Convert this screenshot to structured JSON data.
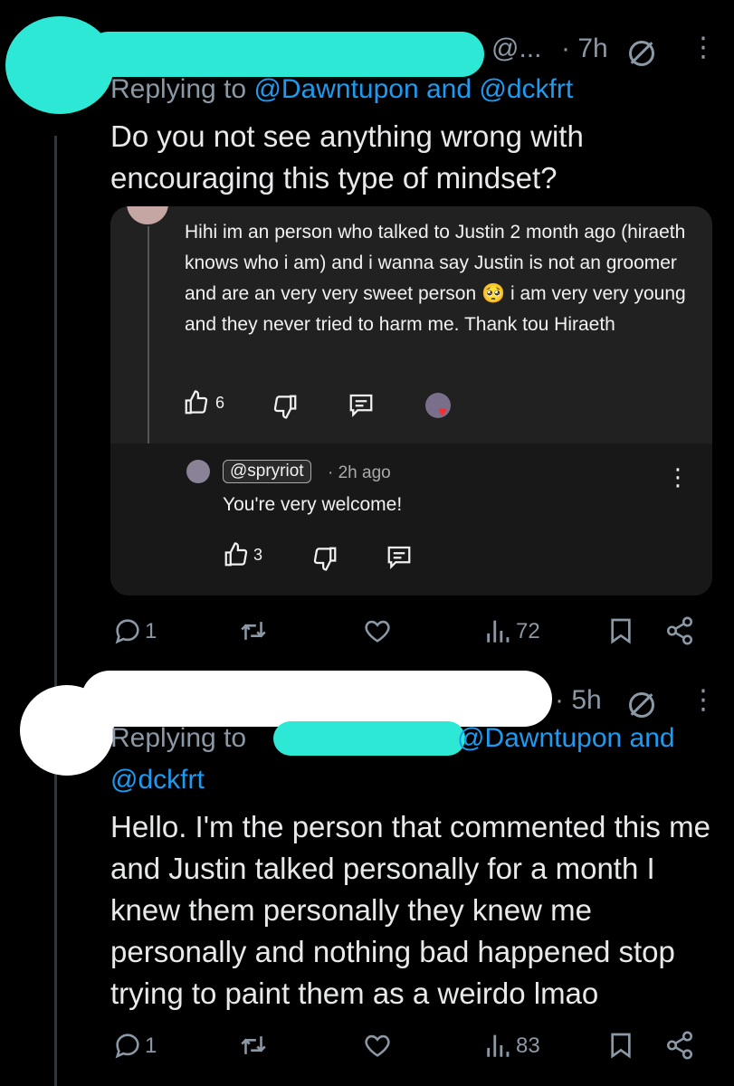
{
  "tweet1": {
    "handle": "@...",
    "time": "· 7h",
    "replying_prefix": "Replying to",
    "replying_handles": "@Dawntupon and @dckfrt",
    "text": "Do you not see anything wrong with encouraging this type of mindset?",
    "embedded": {
      "comment": "Hihi im an person who talked to Justin 2 month ago (hiraeth knows who i am) and i wanna say Justin is not an groomer and are an very very sweet person 🥺 i am very very young and they never tried to harm me. Thank tou Hiraeth",
      "likes": "6",
      "reply_handle": "@spryriot",
      "reply_time": "· 2h ago",
      "reply_text": "You're very welcome!",
      "reply_likes": "3"
    },
    "actions": {
      "replies": "1",
      "views": "72"
    }
  },
  "tweet2": {
    "time": "· 5h",
    "replying_prefix": "Replying to",
    "replying_handles_line1": "@Dawntupon and",
    "replying_handles_line2": "@dckfrt",
    "text": "Hello. I'm the person that commented this me and Justin talked personally for a month I knew them personally they knew me personally and nothing bad happened stop trying to paint them as a weirdo lmao",
    "actions": {
      "replies": "1",
      "views": "83"
    }
  },
  "icons": [
    "more-icon",
    "no-reply-icon",
    "reply-icon",
    "retweet-icon",
    "like-icon",
    "views-icon",
    "bookmark-icon",
    "share-icon",
    "thumbs-up-icon",
    "thumbs-down-icon",
    "comment-icon"
  ],
  "colors": {
    "redaction_teal": "#2de8d4",
    "link": "#1d9bf0",
    "background": "#000000"
  }
}
